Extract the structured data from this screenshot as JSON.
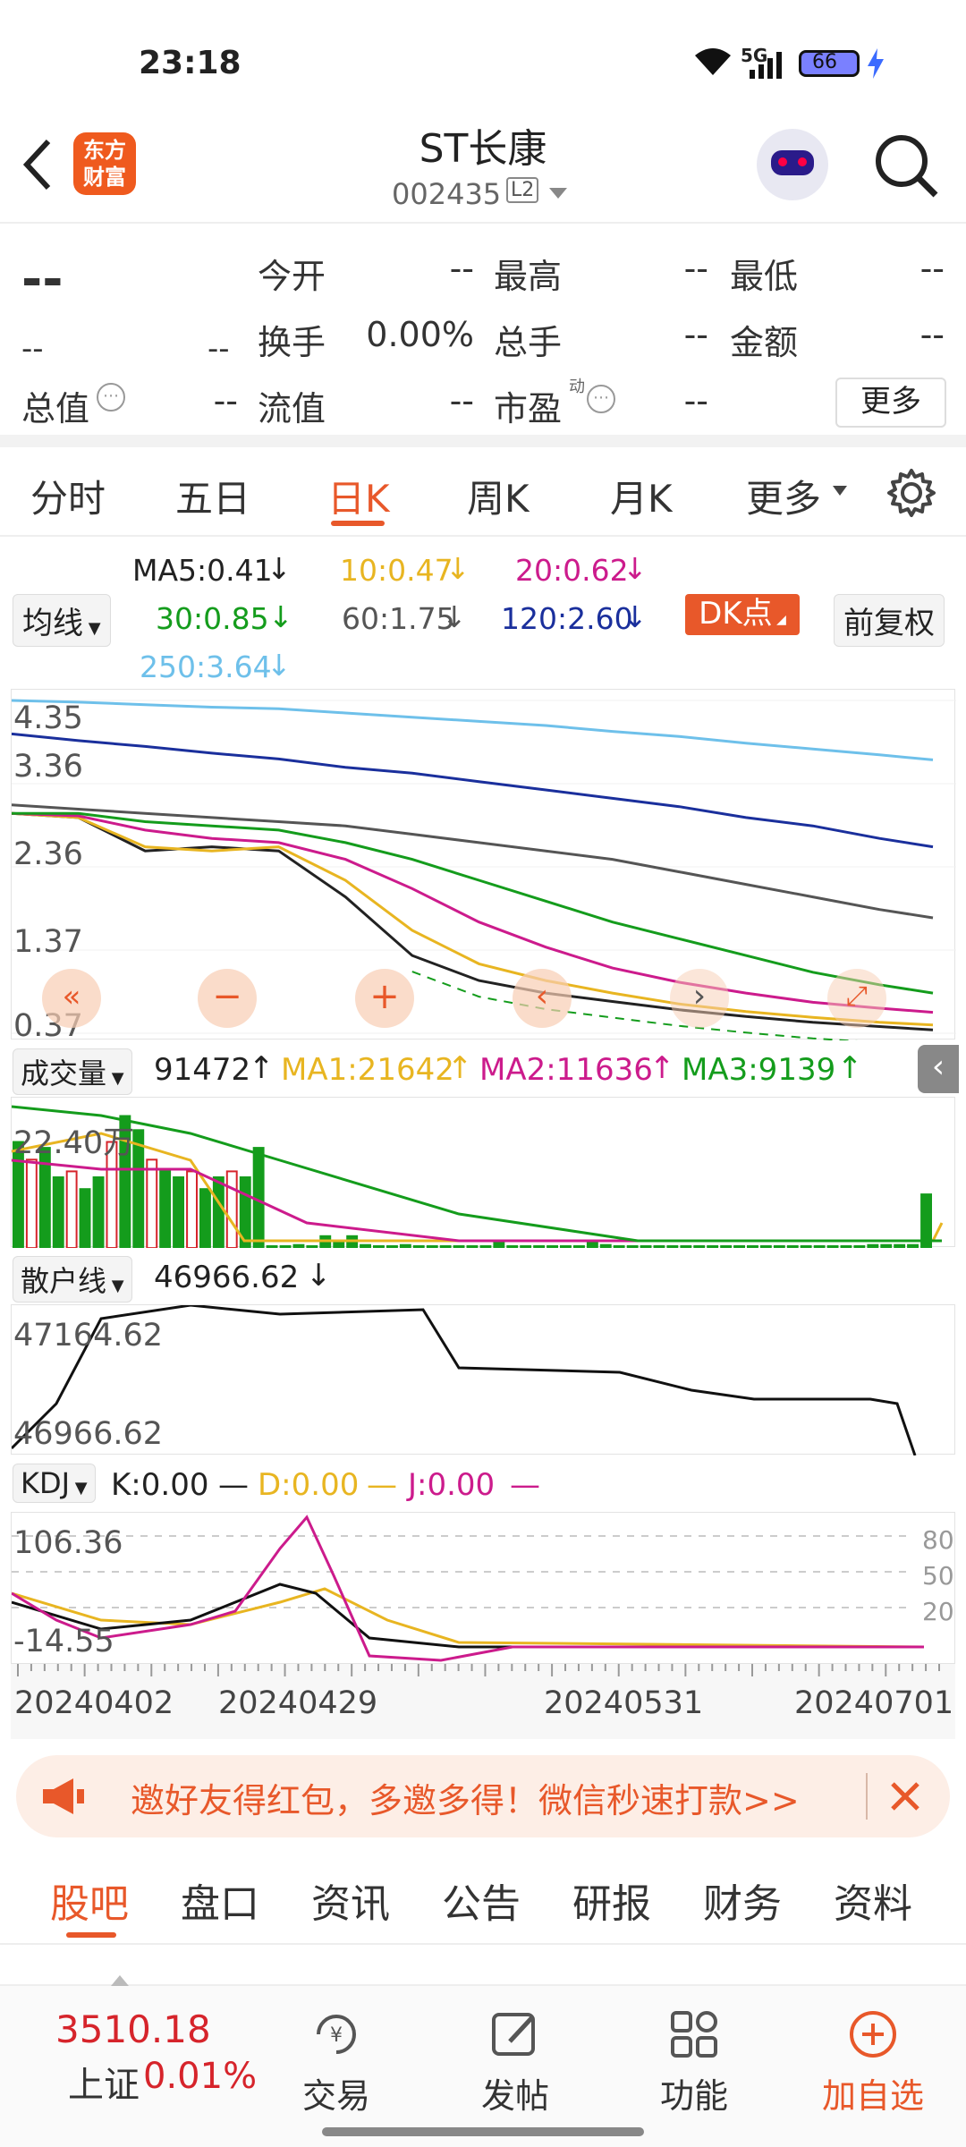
{
  "status_bar": {
    "time": "23:18",
    "network": "5G",
    "battery": "66"
  },
  "header": {
    "title": "ST长康",
    "code": "002435",
    "level": "L2",
    "logo_line1": "东方",
    "logo_line2": "财富"
  },
  "quote": {
    "price": "--",
    "change": "--",
    "change_pct": "--",
    "fields": [
      {
        "label": "今开",
        "value": "--"
      },
      {
        "label": "最高",
        "value": "--"
      },
      {
        "label": "最低",
        "value": "--"
      },
      {
        "label": "换手",
        "value": "0.00%"
      },
      {
        "label": "总手",
        "value": "--"
      },
      {
        "label": "金额",
        "value": "--"
      },
      {
        "label": "总值",
        "value": "--"
      },
      {
        "label": "流值",
        "value": "--"
      },
      {
        "label": "市盈",
        "value": "--"
      }
    ],
    "pe_sup": "动",
    "more_button": "更多"
  },
  "period_tabs": {
    "items": [
      "分时",
      "五日",
      "日K",
      "周K",
      "月K",
      "更多"
    ],
    "active": "日K"
  },
  "ma_legend": {
    "selector": "均线",
    "ma5": "MA5:0.41",
    "ma10": "10:0.47",
    "ma20": "20:0.62",
    "ma30": "30:0.85",
    "ma60": "60:1.75",
    "ma120": "120:2.60",
    "ma250": "250:3.64",
    "dk_button": "DK点",
    "fq_button": "前复权"
  },
  "colors": {
    "accent": "#e8582a",
    "up": "#d6242b",
    "down": "#149c1c",
    "ma5": "#222222",
    "ma10": "#e8b521",
    "ma20": "#cc1b8c",
    "ma30": "#149c1c",
    "ma60": "#555555",
    "ma120": "#1a2f9c",
    "ma250": "#6ec0ea"
  },
  "chart_data": [
    {
      "type": "line",
      "name": "日K",
      "ylim": [
        0.37,
        4.35
      ],
      "y_ticks": [
        "4.35",
        "3.36",
        "2.36",
        "1.37",
        "0.37"
      ],
      "x_ticks": [
        "20240402",
        "20240429",
        "20240531",
        "20240701"
      ],
      "x": [
        0,
        5,
        10,
        15,
        20,
        25,
        30,
        35,
        40,
        45,
        50,
        55,
        60,
        65,
        69
      ],
      "series": [
        {
          "name": "MA5",
          "values": [
            3.0,
            2.95,
            2.55,
            2.6,
            2.55,
            2.0,
            1.3,
            1.0,
            0.85,
            0.75,
            0.65,
            0.57,
            0.5,
            0.45,
            0.41
          ]
        },
        {
          "name": "MA10",
          "values": [
            3.0,
            2.95,
            2.6,
            2.55,
            2.6,
            2.2,
            1.6,
            1.2,
            1.0,
            0.85,
            0.72,
            0.63,
            0.56,
            0.5,
            0.47
          ]
        },
        {
          "name": "MA20",
          "values": [
            3.0,
            2.97,
            2.8,
            2.7,
            2.65,
            2.45,
            2.1,
            1.7,
            1.4,
            1.15,
            0.98,
            0.85,
            0.74,
            0.67,
            0.62
          ]
        },
        {
          "name": "MA30",
          "values": [
            3.0,
            3.0,
            2.9,
            2.85,
            2.8,
            2.65,
            2.45,
            2.2,
            1.95,
            1.7,
            1.5,
            1.3,
            1.1,
            0.95,
            0.85
          ]
        },
        {
          "name": "MA60",
          "values": [
            3.1,
            3.05,
            3.0,
            2.95,
            2.9,
            2.85,
            2.75,
            2.65,
            2.55,
            2.45,
            2.3,
            2.15,
            2.0,
            1.85,
            1.75
          ]
        },
        {
          "name": "MA120",
          "values": [
            3.95,
            3.87,
            3.8,
            3.72,
            3.65,
            3.55,
            3.48,
            3.38,
            3.28,
            3.18,
            3.08,
            2.95,
            2.85,
            2.7,
            2.6
          ]
        },
        {
          "name": "MA250",
          "values": [
            4.35,
            4.33,
            4.3,
            4.27,
            4.25,
            4.2,
            4.15,
            4.1,
            4.05,
            3.98,
            3.92,
            3.84,
            3.77,
            3.7,
            3.64
          ]
        }
      ]
    },
    {
      "type": "bar",
      "name": "成交量",
      "label": "22.40万",
      "values": [
        18,
        15,
        17,
        12,
        13,
        10,
        12,
        18,
        22.4,
        20,
        15,
        13,
        12,
        13,
        10,
        12,
        13,
        12,
        17,
        0.2,
        0.3,
        0.5,
        0.3,
        2,
        1,
        2,
        0.5,
        0.3,
        0.3,
        0.5,
        0.3,
        0.3,
        0.3,
        0.3,
        0.3,
        0.3,
        1,
        0.3,
        0.3,
        0.3,
        0.3,
        0.3,
        0.3,
        1,
        0.5,
        0.3,
        0.3,
        0.3,
        0.3,
        0.3,
        0.3,
        0.3,
        0.3,
        0.3,
        0.3,
        0.3,
        0.3,
        0.3,
        0.3,
        0.3,
        0.3,
        0.3,
        0.3,
        0.3,
        0.5,
        0.5,
        0.5,
        0.5,
        9.1
      ]
    },
    {
      "type": "line",
      "name": "散户线",
      "ylim": [
        46966.62,
        47164.62
      ],
      "y_ticks": [
        "47164.62",
        "46966.62"
      ]
    },
    {
      "type": "line",
      "name": "KDJ",
      "ylim": [
        -14.55,
        106.36
      ],
      "y_ticks": [
        "106.36",
        "-14.55"
      ],
      "right_ticks": [
        "80",
        "50",
        "20"
      ]
    }
  ],
  "volume": {
    "selector": "成交量",
    "value": "91472",
    "ma1": "MA1:21642",
    "ma2": "MA2:11636",
    "ma3": "MA3:9139"
  },
  "retail": {
    "selector": "散户线",
    "value": "46966.62"
  },
  "kdj": {
    "selector": "KDJ",
    "k": "K:0.00",
    "d": "D:0.00",
    "j": "J:0.00"
  },
  "banner": {
    "text": "邀好友得红包，多邀多得！微信秒速打款>>"
  },
  "bottom_tabs": [
    "股吧",
    "盘口",
    "资讯",
    "公告",
    "研报",
    "财务",
    "资料"
  ],
  "index_bar": {
    "value": "3510.18",
    "name": "上证",
    "change": "0.01%"
  },
  "bottom_nav": [
    "交易",
    "发帖",
    "功能",
    "加自选"
  ]
}
